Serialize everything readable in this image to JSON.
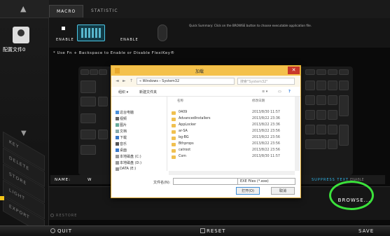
{
  "sidebar": {
    "profile_name": "配置文件0",
    "tabs": [
      "KEY",
      "DELETE",
      "STORE",
      "LIGHT",
      "EXPORT"
    ]
  },
  "tabs": [
    {
      "label": "MACRO"
    },
    {
      "label": "STATISTIC"
    }
  ],
  "header": {
    "enable_left": "ENABLE",
    "enable_right": "ENABLE",
    "hint": "Quick Summary: Click on the BROWSE button to choose executable application file.",
    "use_fn": "* Use Fn + Backspace to Enable or Disable FlexiKey®"
  },
  "name_bar": {
    "label": "NAME:",
    "value": "W",
    "suppress": "SUPPRESS TEXT",
    "enable": "ENABLE"
  },
  "panel": {
    "browse": "BROWSE...",
    "restore": "RESTORE"
  },
  "bottom": {
    "quit": "QUIT",
    "reset": "RESET",
    "save": "SAVE"
  },
  "dialog": {
    "title": "加载",
    "close": "✕",
    "breadcrumb": "«  Windows  ›  System32",
    "search_placeholder": "搜索\"System32\"",
    "toolbar": {
      "organize": "组织 ▾",
      "new_folder": "新建文件夹"
    },
    "columns": {
      "name": "名称",
      "date": "修改日期"
    },
    "tree": [
      "这台电脑",
      "视频",
      "图片",
      "文档",
      "下载",
      "音乐",
      "桌面",
      "本地磁盘 (C:)",
      "本地磁盘 (D:)",
      "DATA (E:)"
    ],
    "files": [
      {
        "name": "0409",
        "date": "2013/8/30 11:57"
      },
      {
        "name": "AdvancedInstallers",
        "date": "2013/8/22 23:36"
      },
      {
        "name": "AppLocker",
        "date": "2013/8/22 23:36"
      },
      {
        "name": "ar-SA",
        "date": "2013/8/22 23:56"
      },
      {
        "name": "bg-BG",
        "date": "2013/8/22 23:56"
      },
      {
        "name": "Bthprops",
        "date": "2013/8/22 23:56"
      },
      {
        "name": "catroot",
        "date": "2013/8/22 23:56"
      },
      {
        "name": "Com",
        "date": "2013/8/30 11:57"
      }
    ],
    "filename_label": "文件名(N):",
    "filter": "EXE Files (*.exe)",
    "open": "打开(O)",
    "cancel": "取消"
  }
}
